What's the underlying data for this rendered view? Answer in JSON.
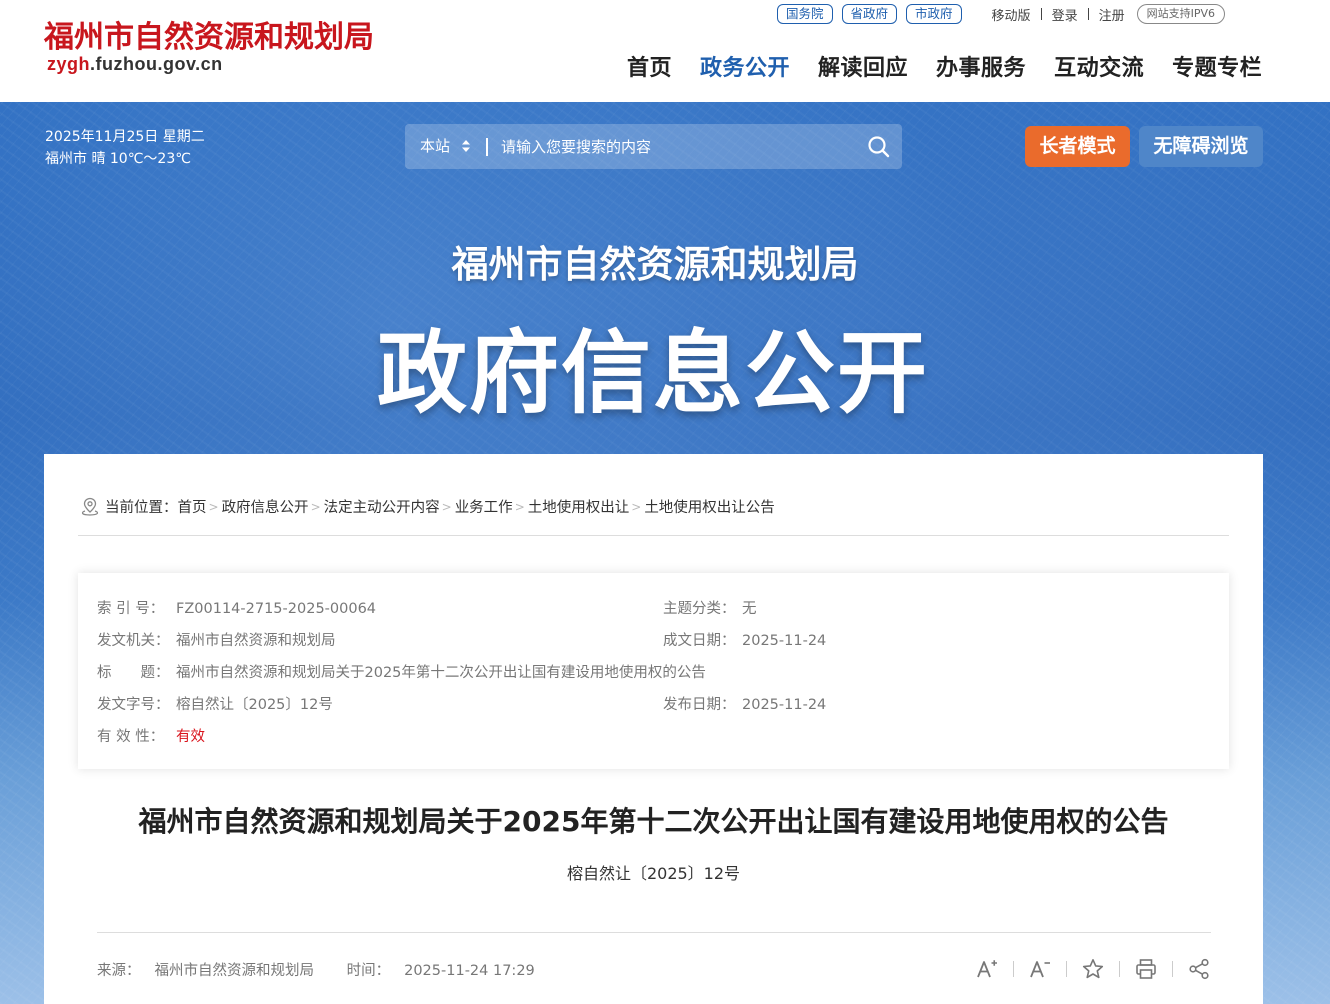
{
  "header": {
    "logo_cn": "福州市自然资源和规划局",
    "logo_en_prefix": "zygh",
    "logo_en_rest": ".fuzhou.gov.cn",
    "gov_links": [
      "国务院",
      "省政府",
      "市政府"
    ],
    "mobile": "移动版",
    "login": "登录",
    "register": "注册",
    "ipv6": "网站支持IPV6",
    "nav": [
      "首页",
      "政务公开",
      "解读回应",
      "办事服务",
      "互动交流",
      "专题专栏"
    ],
    "active_nav": "政务公开"
  },
  "banner": {
    "date": "2025年11月25日 星期二",
    "weather": "福州市 晴 10℃～23℃",
    "search_scope": "本站",
    "search_placeholder": "请输入您要搜索的内容",
    "elder_mode": "长者模式",
    "accessible": "无障碍浏览",
    "subtitle": "福州市自然资源和规划局",
    "title": "政府信息公开"
  },
  "breadcrumb": {
    "label": "当前位置：",
    "items": [
      "首页",
      "政府信息公开",
      "法定主动公开内容",
      "业务工作",
      "土地使用权出让",
      "土地使用权出让公告"
    ]
  },
  "meta": {
    "index_label": "索 引 号：",
    "index_value": "FZ00114-2715-2025-00064",
    "topic_label": "主题分类：",
    "topic_value": "无",
    "issuer_label": "发文机关：",
    "issuer_value": "福州市自然资源和规划局",
    "created_label": "成文日期：",
    "created_value": "2025-11-24",
    "title_label": "标　　题：",
    "title_value": "福州市自然资源和规划局关于2025年第十二次公开出让国有建设用地使用权的公告",
    "docno_label": "发文字号：",
    "docno_value": "榕自然让〔2025〕12号",
    "published_label": "发布日期：",
    "published_value": "2025-11-24",
    "validity_label": "有 效 性：",
    "validity_value": "有效"
  },
  "document": {
    "title": "福州市自然资源和规划局关于2025年第十二次公开出让国有建设用地使用权的公告",
    "number": "榕自然让〔2025〕12号",
    "source_label": "来源：",
    "source": "福州市自然资源和规划局",
    "time_label": "时间：",
    "time": "2025-11-24 17:29"
  },
  "colors": {
    "brand_red": "#c8161d",
    "brand_blue": "#1f5fae",
    "elder_orange": "#ea6b2c"
  }
}
